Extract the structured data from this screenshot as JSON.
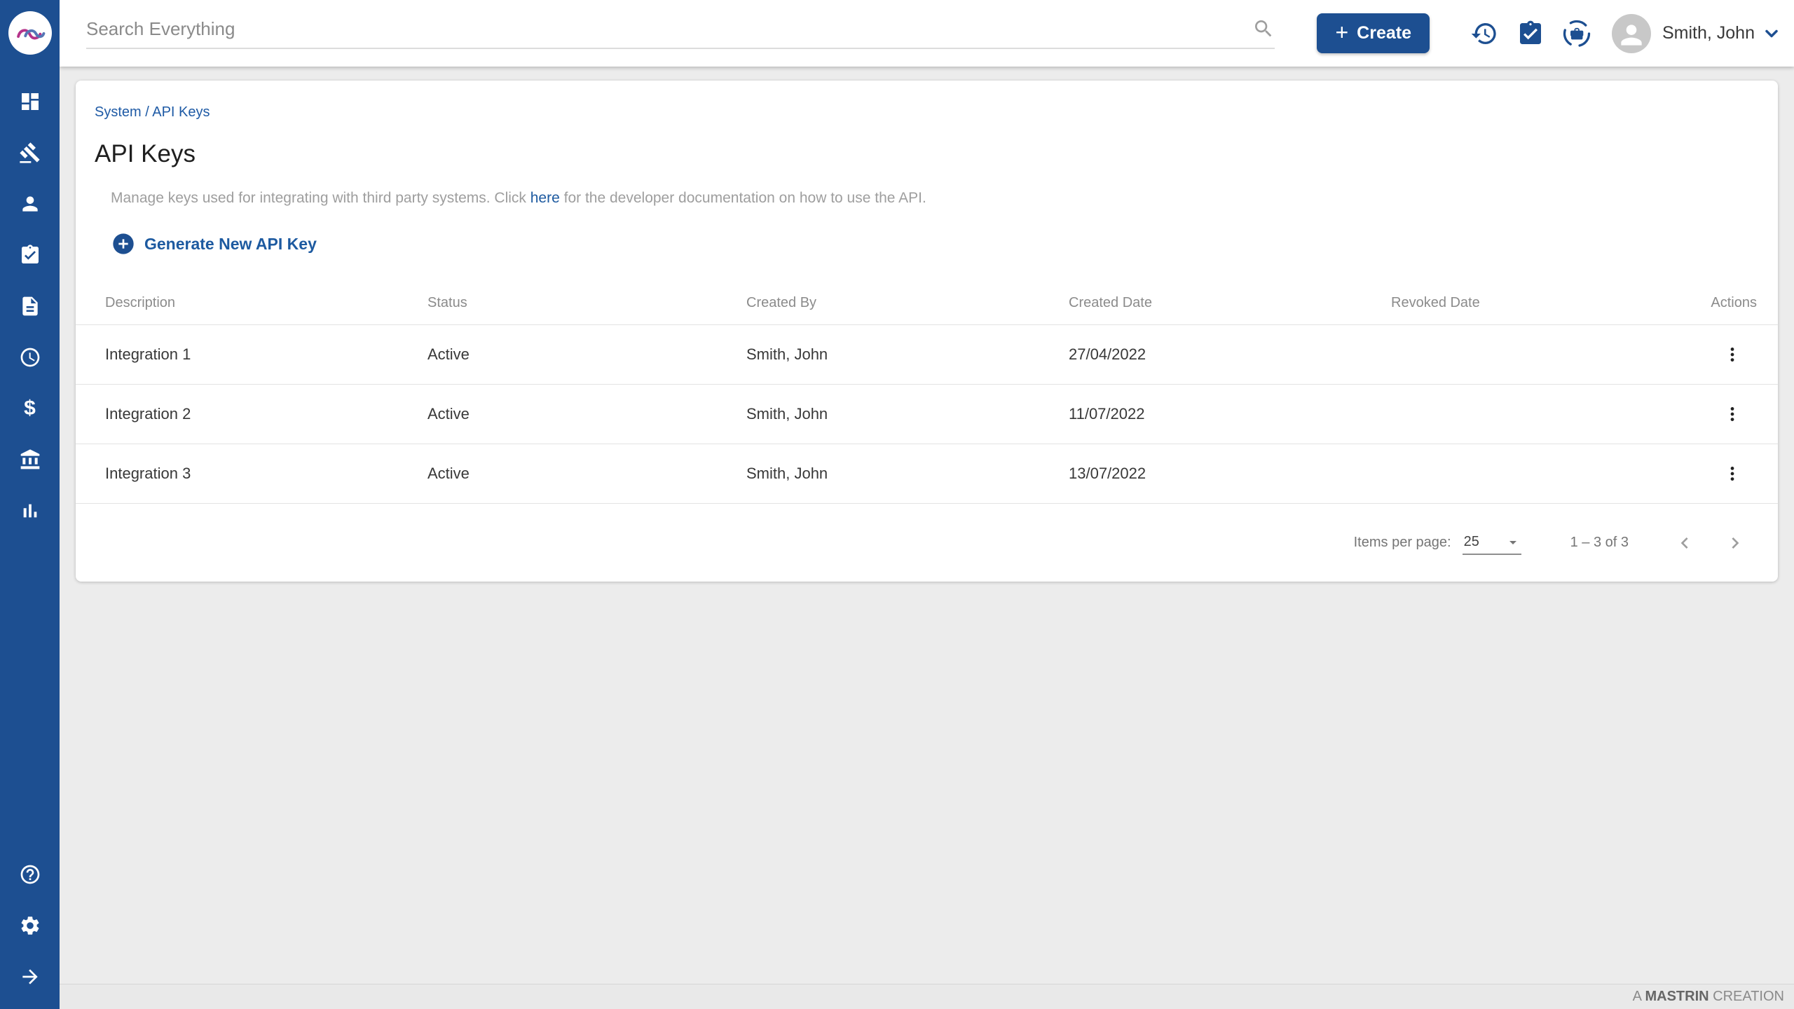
{
  "colors": {
    "primary_blue": "#1d4f91",
    "link_blue": "#1e5aa5",
    "page_background": "#ececec",
    "card_background": "#ffffff",
    "text_dark": "#383838",
    "text_gray": "#8b8b8b"
  },
  "topbar": {
    "search": {
      "placeholder": "Search Everything"
    },
    "create_button": {
      "label": "Create",
      "plus": "+"
    },
    "icons": [
      "history-icon",
      "tasks-clipboard-icon",
      "sync-briefcase-icon"
    ],
    "user": {
      "name": "Smith, John"
    }
  },
  "sidebar": {
    "icons": [
      "dashboard-icon",
      "gavel-icon",
      "person-icon",
      "clipboard-check-icon",
      "document-icon",
      "clock-icon",
      "dollar-icon",
      "bank-icon",
      "bar-chart-icon"
    ],
    "bottom_icons": [
      "help-icon",
      "settings-icon",
      "arrow-right-icon"
    ],
    "dollar_glyph": "$"
  },
  "page": {
    "breadcrumb": "System / API Keys",
    "title": "API Keys",
    "description": {
      "before_link": "Manage keys used for integrating with third party systems. Click ",
      "link": "here",
      "after_link": " for the developer documentation on how to use the API."
    },
    "generate_button": "Generate New API Key"
  },
  "table": {
    "columns": {
      "description": "Description",
      "status": "Status",
      "created_by": "Created By",
      "created_date": "Created Date",
      "revoked_date": "Revoked Date",
      "actions": "Actions"
    },
    "rows": [
      {
        "description": "Integration 1",
        "status": "Active",
        "created_by": "Smith, John",
        "created_date": "27/04/2022",
        "revoked_date": ""
      },
      {
        "description": "Integration 2",
        "status": "Active",
        "created_by": "Smith, John",
        "created_date": "11/07/2022",
        "revoked_date": ""
      },
      {
        "description": "Integration 3",
        "status": "Active",
        "created_by": "Smith, John",
        "created_date": "13/07/2022",
        "revoked_date": ""
      }
    ]
  },
  "pagination": {
    "items_per_page_label": "Items per page:",
    "items_per_page_value": "25",
    "range": "1 – 3 of 3"
  },
  "footer": {
    "prefix": "A ",
    "brand": "MASTRIN",
    "suffix": " CREATION"
  }
}
